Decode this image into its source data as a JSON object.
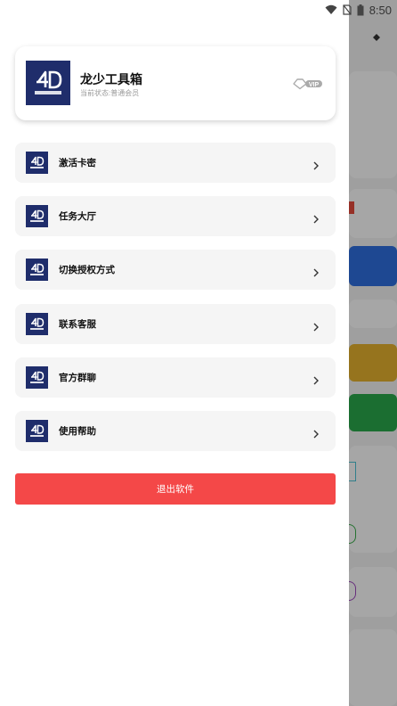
{
  "status_bar": {
    "time": "8:50"
  },
  "profile": {
    "app_name": "龙少工具箱",
    "status_text": "当前状态:普通会员",
    "badge": "VIP"
  },
  "menu": [
    {
      "label": "激活卡密",
      "icon": "app-logo-icon"
    },
    {
      "label": "任务大厅",
      "icon": "app-logo-icon"
    },
    {
      "label": "切换授权方式",
      "icon": "app-logo-icon"
    },
    {
      "label": "联系客服",
      "icon": "app-logo-icon"
    },
    {
      "label": "官方群聊",
      "icon": "app-logo-icon"
    },
    {
      "label": "使用帮助",
      "icon": "app-logo-icon"
    }
  ],
  "logout_label": "退出软件",
  "colors": {
    "logo_bg": "#1f2d6b",
    "logout": "#f44848",
    "menu_bg": "#f5f5f5"
  }
}
